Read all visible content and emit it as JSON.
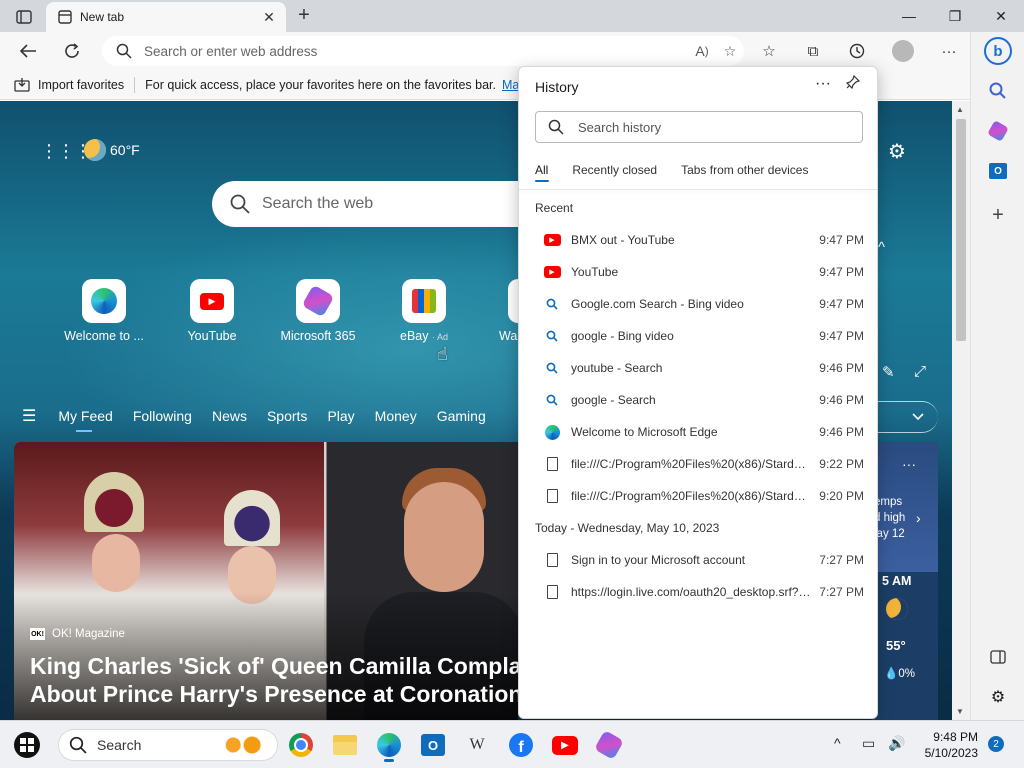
{
  "browser": {
    "tab": {
      "title": "New tab"
    },
    "address": {
      "placeholder": "Search or enter web address"
    },
    "favorites_bar": {
      "import_label": "Import favorites",
      "hint": "For quick access, place your favorites here on the favorites bar.",
      "manage_link": "Mana"
    }
  },
  "new_tab_page": {
    "weather": {
      "temp": "60°F"
    },
    "search_placeholder": "Search the web",
    "quick_links": [
      {
        "label": "Welcome to ...",
        "icon": "edge-icon"
      },
      {
        "label": "YouTube",
        "icon": "youtube-icon"
      },
      {
        "label": "Microsoft 365",
        "icon": "microsoft-365-icon"
      },
      {
        "label": "eBay",
        "ad": "· Ad",
        "icon": "ebay-icon"
      },
      {
        "label": "Wa",
        "icon": "walmart-icon"
      }
    ],
    "feed_tabs": [
      "My Feed",
      "Following",
      "News",
      "Sports",
      "Play",
      "Money",
      "Gaming"
    ],
    "active_feed_tab": "My Feed",
    "hero": {
      "source": "OK! Magazine",
      "source_logo": "OK!",
      "title": "King Charles 'Sick of' Queen Camilla Complai About Prince Harry's Presence at Coronation:"
    },
    "side_card": {
      "line1": "emps",
      "line2": "d high",
      "line3": "lay 12",
      "time": "5 AM",
      "temp": "55°",
      "precip": "0%"
    }
  },
  "history": {
    "title": "History",
    "search_placeholder": "Search history",
    "tabs": [
      "All",
      "Recently closed",
      "Tabs from other devices"
    ],
    "active_tab": "All",
    "sections": [
      {
        "heading": "Recent",
        "items": [
          {
            "label": "BMX out - YouTube",
            "time": "9:47 PM",
            "icon": "youtube-icon"
          },
          {
            "label": "YouTube",
            "time": "9:47 PM",
            "icon": "youtube-icon"
          },
          {
            "label": "Google.com Search - Bing video",
            "time": "9:47 PM",
            "icon": "search-icon"
          },
          {
            "label": "google - Bing video",
            "time": "9:47 PM",
            "icon": "search-icon"
          },
          {
            "label": "youtube - Search",
            "time": "9:46 PM",
            "icon": "search-icon"
          },
          {
            "label": "google - Search",
            "time": "9:46 PM",
            "icon": "search-icon"
          },
          {
            "label": "Welcome to Microsoft Edge",
            "time": "9:46 PM",
            "icon": "edge-icon"
          },
          {
            "label": "file:///C:/Program%20Files%20(x86)/Stardock...",
            "time": "9:22 PM",
            "icon": "file-icon"
          },
          {
            "label": "file:///C:/Program%20Files%20(x86)/Stardock...",
            "time": "9:20 PM",
            "icon": "file-icon"
          }
        ]
      },
      {
        "heading": "Today - Wednesday, May 10, 2023",
        "items": [
          {
            "label": "Sign in to your Microsoft account",
            "time": "7:27 PM",
            "icon": "file-icon"
          },
          {
            "label": "https://login.live.com/oauth20_desktop.srf?lc...",
            "time": "7:27 PM",
            "icon": "file-icon"
          }
        ]
      }
    ]
  },
  "taskbar": {
    "search_label": "Search",
    "wiki_glyph": "W",
    "outlook_glyph": "O",
    "facebook_glyph": "f",
    "clock_time": "9:48 PM",
    "clock_date": "5/10/2023",
    "notification_count": "2"
  },
  "colors": {
    "accent": "#0f6cbd",
    "youtube_red": "#ff0000",
    "titlebar": "#d4d7db"
  }
}
